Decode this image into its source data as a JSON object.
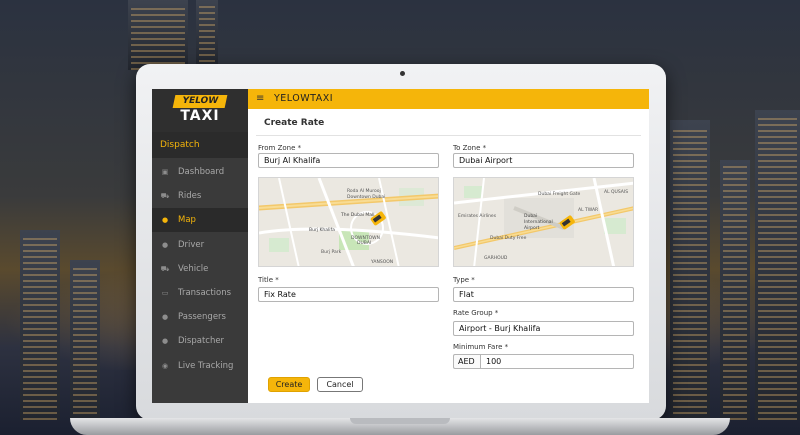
{
  "brand": {
    "logo_top": "YELOW",
    "logo_bottom": "TAXI",
    "app_name": "YELOWTAXI",
    "accent": "#f5b50a"
  },
  "sidebar": {
    "section": "Dispatch",
    "items": [
      {
        "label": "Dashboard",
        "icon": "dashboard-icon"
      },
      {
        "label": "Rides",
        "icon": "car-icon"
      },
      {
        "label": "Map",
        "icon": "map-pin-icon",
        "active": true
      },
      {
        "label": "Driver",
        "icon": "user-icon"
      },
      {
        "label": "Vehicle",
        "icon": "car-icon"
      },
      {
        "label": "Transactions",
        "icon": "wallet-icon"
      },
      {
        "label": "Passengers",
        "icon": "users-icon"
      },
      {
        "label": "Dispatcher",
        "icon": "user-icon"
      },
      {
        "label": "Live Tracking",
        "icon": "location-icon"
      }
    ]
  },
  "form": {
    "title": "Create Rate",
    "from_zone": {
      "label": "From Zone *",
      "value": "Burj Al Khalifa"
    },
    "to_zone": {
      "label": "To Zone *",
      "value": "Dubai Airport"
    },
    "title_field": {
      "label": "Title *",
      "value": "Fix Rate"
    },
    "type_field": {
      "label": "Type *",
      "value": "Flat"
    },
    "rate_group": {
      "label": "Rate Group *",
      "value": "Airport - Burj Khalifa"
    },
    "minimum_fare": {
      "label": "Minimum Fare *",
      "prefix": "AED",
      "value": "100"
    },
    "create_label": "Create",
    "cancel_label": "Cancel"
  },
  "maps": {
    "left": {
      "labels": [
        "Roda Al Murooj",
        "Downtown Dubai",
        "The Dubai Mall",
        "DOWNTOWN",
        "DUBAI",
        "Burj Khalifa",
        "Burj Park",
        "YANSOON"
      ]
    },
    "right": {
      "labels": [
        "Dubai Freight Gate",
        "AL QUSAIS",
        "Emirates Airlines",
        "Dubai",
        "International",
        "Airport",
        "AL TWAR",
        "Dubai Duty Free",
        "GARHOUD"
      ]
    }
  }
}
